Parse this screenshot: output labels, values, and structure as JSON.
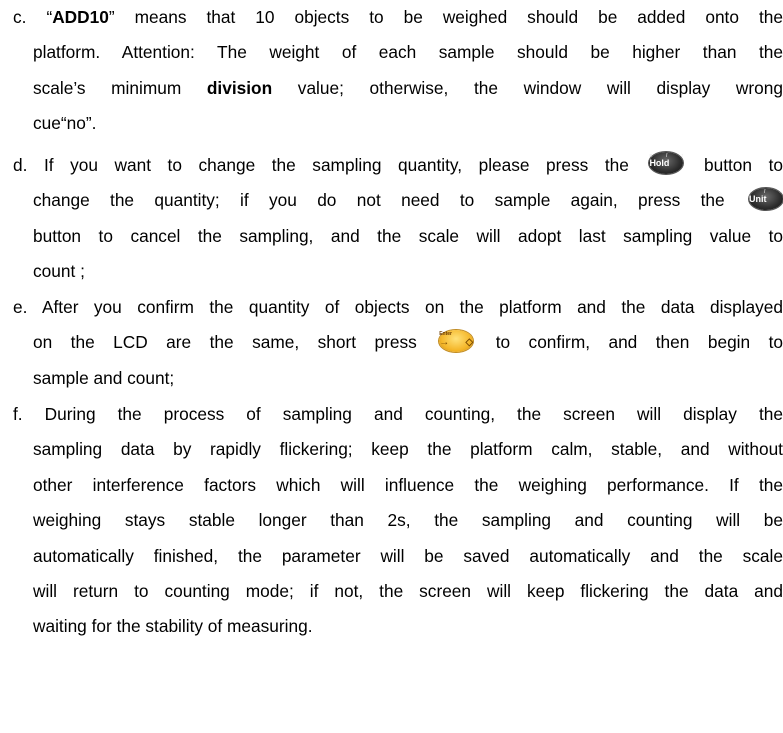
{
  "items": [
    {
      "label": "c.",
      "lines": [
        {
          "pre": "“",
          "bold": "ADD10",
          "post": "” means that 10 objects to be weighed should be added onto the"
        },
        {
          "text": "platform. Attention: The weight of each sample should be higher than the"
        },
        {
          "pre": "scale’s minimum ",
          "bold": "division",
          "post": " value; otherwise, the window will display wrong"
        },
        {
          "text": "cue“no”."
        }
      ]
    },
    {
      "label": "d.",
      "lines": [
        {
          "pre": "If you want to change the sampling quantity, please press the",
          "button": "hold",
          "post": "button to"
        },
        {
          "pre": "change the quantity; if you do not need to sample again, press the",
          "button": "unit",
          "post": ""
        },
        {
          "text": "button to cancel the sampling, and the scale will adopt last sampling value to"
        },
        {
          "text": "count ;"
        }
      ]
    },
    {
      "label": "e.",
      "lines": [
        {
          "text": "After you confirm the quantity of objects on the platform and the data displayed"
        },
        {
          "pre": "on the LCD are the same, short press",
          "button": "enter",
          "post": "to confirm, and then begin to"
        },
        {
          "text": "sample and count;"
        }
      ]
    },
    {
      "label": "f.",
      "lines": [
        {
          "text": "During the process of sampling and counting, the screen will display the"
        },
        {
          "text": "sampling data by rapidly flickering; keep the platform calm, stable, and without"
        },
        {
          "text": "other interference factors which will influence the weighing performance. If the"
        },
        {
          "text": "weighing stays stable longer than 2s, the sampling and counting will be"
        },
        {
          "text": "automatically finished, the parameter will be saved automatically and the scale"
        },
        {
          "text": "will return to counting mode; if not, the screen will keep flickering the data and"
        },
        {
          "text": "waiting for the stability of measuring."
        }
      ]
    }
  ],
  "buttons": {
    "hold": {
      "label": "Hold",
      "sub": "≡ / ↑",
      "icon": "hold-button-icon"
    },
    "unit": {
      "label": "Unit",
      "sub": "↓ / →",
      "icon": "unit-button-icon"
    },
    "enter": {
      "label": "→◇",
      "sub": "Enter",
      "icon": "enter-button-icon"
    }
  }
}
